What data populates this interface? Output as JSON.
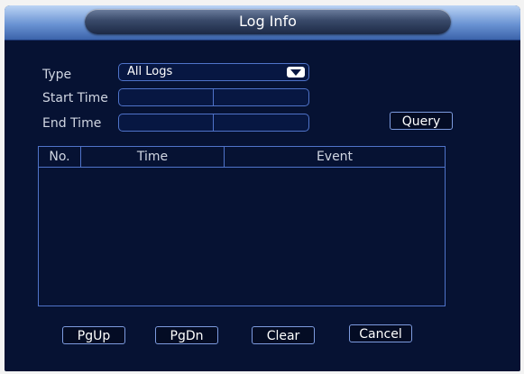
{
  "window": {
    "title": "Log Info"
  },
  "form": {
    "type_label": "Type",
    "type_value": "All Logs",
    "start_time_label": "Start  Time",
    "start_date": "",
    "start_time": "",
    "end_time_label": "End Time",
    "end_date": "",
    "end_time": "",
    "query_label": "Query"
  },
  "table": {
    "columns": [
      "No.",
      "Time",
      "Event"
    ],
    "rows": []
  },
  "footer": {
    "pgup_label": "PgUp",
    "pgdn_label": "PgDn",
    "clear_label": "Clear",
    "cancel_label": "Cancel"
  },
  "colors": {
    "panel_bg": "#061233",
    "border_accent": "#4f73c9",
    "header_gradient_top": "#bcd4f5",
    "header_gradient_bottom": "#3b63aa"
  }
}
